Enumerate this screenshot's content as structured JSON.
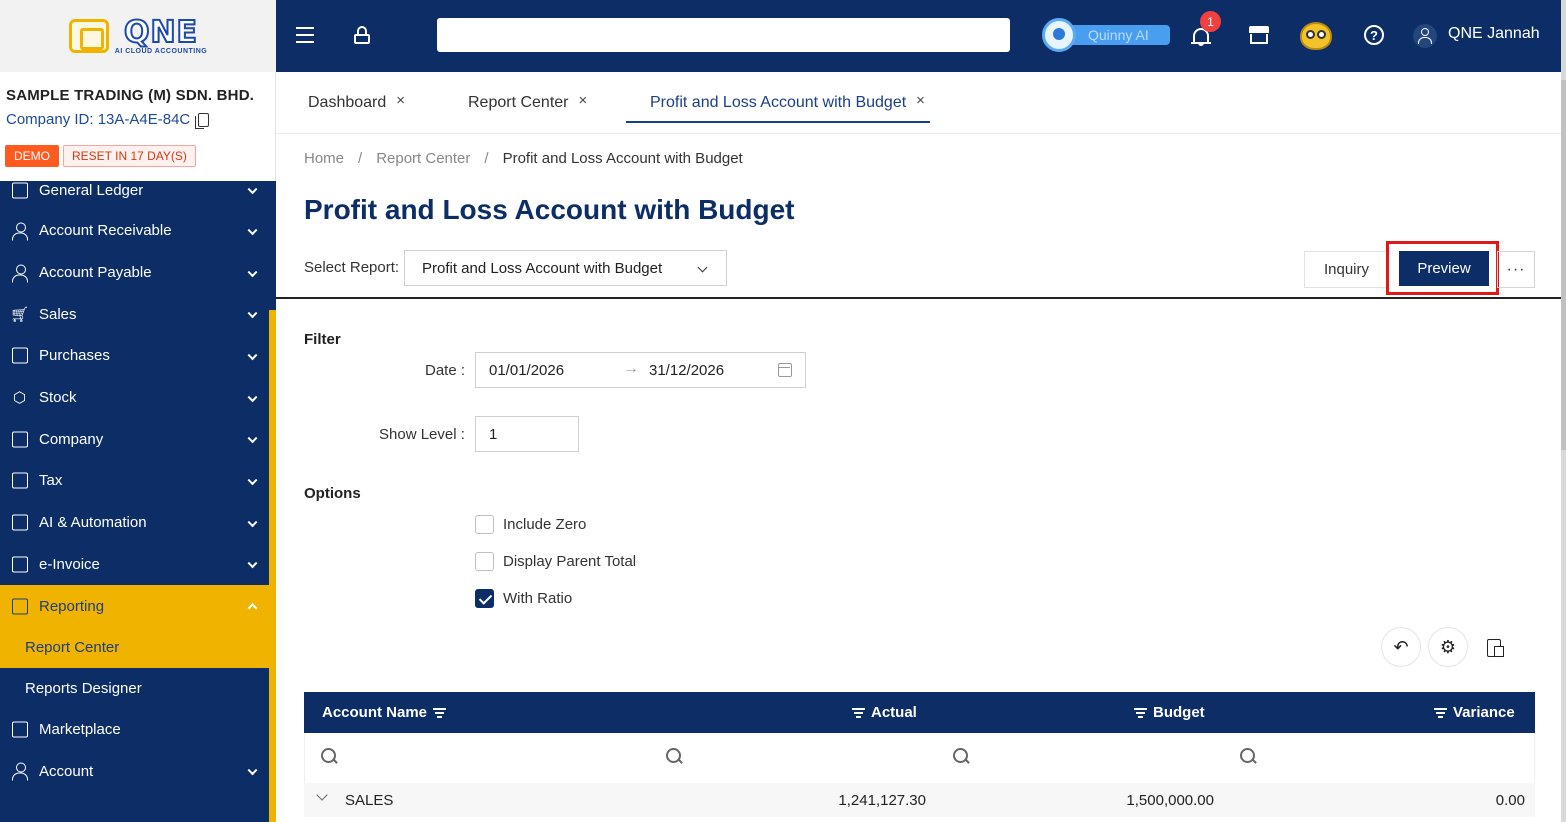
{
  "brand": {
    "logo_text": "QNE",
    "logo_tagline": "AI CLOUD ACCOUNTING"
  },
  "company": {
    "name": "SAMPLE TRADING (M) SDN. BHD.",
    "id_label": "Company ID: 13A-A4E-84C",
    "demo_badge": "DEMO",
    "reset_badge": "RESET IN 17 DAY(S)"
  },
  "sidebar": {
    "items": [
      {
        "label": "General Ledger",
        "icon": "ledger-icon"
      },
      {
        "label": "Account Receivable",
        "icon": "receivable-icon"
      },
      {
        "label": "Account Payable",
        "icon": "payable-icon"
      },
      {
        "label": "Sales",
        "icon": "cart-icon"
      },
      {
        "label": "Purchases",
        "icon": "purchases-icon"
      },
      {
        "label": "Stock",
        "icon": "box-icon"
      },
      {
        "label": "Company",
        "icon": "company-icon"
      },
      {
        "label": "Tax",
        "icon": "tax-icon"
      },
      {
        "label": "AI & Automation",
        "icon": "ai-icon"
      },
      {
        "label": "e-Invoice",
        "icon": "file-icon"
      },
      {
        "label": "Reporting",
        "icon": "chart-icon"
      },
      {
        "label": "Report Center"
      },
      {
        "label": "Reports Designer"
      },
      {
        "label": "Marketplace",
        "icon": "store-icon"
      },
      {
        "label": "Account",
        "icon": "user-icon"
      }
    ]
  },
  "header": {
    "assistant_label": "Quinny AI",
    "notification_count": "1",
    "user_name": "QNE Jannah",
    "help_glyph": "?"
  },
  "tabs": [
    {
      "label": "Dashboard",
      "close": "×"
    },
    {
      "label": "Report Center",
      "close": "×"
    },
    {
      "label": "Profit and Loss Account with Budget",
      "close": "×"
    }
  ],
  "breadcrumb": {
    "home": "Home",
    "sep": "/",
    "section": "Report Center",
    "current": "Profit and Loss Account with Budget"
  },
  "page": {
    "title": "Profit and Loss Account with Budget",
    "select_label": "Select Report:",
    "selected_report": "Profit and Loss Account with Budget",
    "inquiry_label": "Inquiry",
    "preview_label": "Preview",
    "more_label": "···"
  },
  "filter": {
    "heading": "Filter",
    "date_label": "Date :",
    "date_from": "01/01/2026",
    "date_arrow": "→",
    "date_to": "31/12/2026",
    "level_label": "Show Level :",
    "level_value": "1"
  },
  "options": {
    "heading": "Options",
    "include_zero": {
      "label": "Include Zero",
      "checked": false
    },
    "display_parent_total": {
      "label": "Display Parent Total",
      "checked": false
    },
    "with_ratio": {
      "label": "With Ratio",
      "checked": true
    }
  },
  "toolbar": {
    "undo_glyph": "↶",
    "settings_glyph": "⚙"
  },
  "grid": {
    "columns": [
      "Account Name",
      "Actual",
      "Budget",
      "Variance"
    ],
    "rows": [
      {
        "name": "SALES",
        "actual": "1,241,127.30",
        "budget": "1,500,000.00",
        "variance": "0.00"
      }
    ]
  }
}
